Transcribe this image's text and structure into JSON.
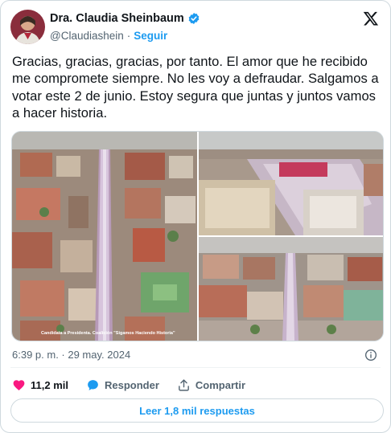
{
  "header": {
    "name": "Dra. Claudia Sheinbaum",
    "handle": "@Claudiashein",
    "separator": "·",
    "follow_label": "Seguir"
  },
  "post": {
    "text": "Gracias, gracias, gracias, por tanto. El amor que he recibido me compromete siempre. No les voy a defraudar. Salgamos a votar este 2 de junio. Estoy segura que juntas y juntos vamos a hacer historia.",
    "image_caption": "Candidata a Presidenta. Coalición \"Sigamos Haciendo Historia\"",
    "timestamp": "6:39 p. m. · 29 may. 2024"
  },
  "actions": {
    "likes": "11,2 mil",
    "reply_label": "Responder",
    "share_label": "Compartir"
  },
  "read_more": "Leer 1,8 mil respuestas",
  "colors": {
    "accent": "#1d9bf0",
    "like": "#f91880",
    "text": "#0f1419",
    "muted": "#536471"
  },
  "icons": [
    "avatar",
    "verified-badge-icon",
    "x-logo-icon",
    "info-icon",
    "heart-icon",
    "reply-icon",
    "share-icon"
  ]
}
